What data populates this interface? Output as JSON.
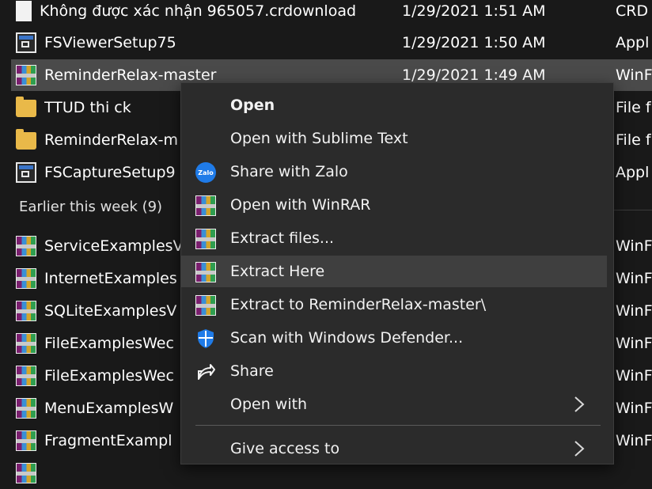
{
  "files": [
    {
      "name": "Không được xác nhận 965057.crdownload",
      "date": "1/29/2021 1:51 AM",
      "type": "CRD",
      "icon": "document-icon"
    },
    {
      "name": "FSViewerSetup75",
      "date": "1/29/2021 1:50 AM",
      "type": "Appl",
      "icon": "application-icon"
    },
    {
      "name": "ReminderRelax-master",
      "date": "1/29/2021 1:49 AM",
      "type": "WinF",
      "icon": "winrar-icon",
      "selected": true
    },
    {
      "name": "TTUD thi ck",
      "date": "",
      "type": "File f",
      "icon": "folder-icon"
    },
    {
      "name": "ReminderRelax-m",
      "date": "",
      "type": "File f",
      "icon": "folder-icon"
    },
    {
      "name": "FSCaptureSetup9",
      "date": "",
      "type": "Appl",
      "icon": "application-icon"
    }
  ],
  "group_header": "Earlier this week (9)",
  "files_earlier": [
    {
      "name": "ServiceExamplesV",
      "type": "WinF"
    },
    {
      "name": "InternetExamples",
      "type": "WinF"
    },
    {
      "name": "SQLiteExamplesV",
      "type": "WinF"
    },
    {
      "name": "FileExamplesWec",
      "type": "WinF"
    },
    {
      "name": "FileExamplesWec",
      "type": "WinF"
    },
    {
      "name": "MenuExamplesW",
      "type": "WinF"
    },
    {
      "name": "FragmentExampl",
      "type": "WinF"
    }
  ],
  "context_menu": {
    "items": [
      {
        "label": "Open",
        "icon": "",
        "bold": true
      },
      {
        "label": "Open with Sublime Text",
        "icon": ""
      },
      {
        "label": "Share with Zalo",
        "icon": "zalo-icon"
      },
      {
        "label": "Open with WinRAR",
        "icon": "winrar-icon"
      },
      {
        "label": "Extract files...",
        "icon": "winrar-icon"
      },
      {
        "label": "Extract Here",
        "icon": "winrar-icon",
        "hover": true
      },
      {
        "label": "Extract to ReminderRelax-master\\",
        "icon": "winrar-icon"
      },
      {
        "label": "Scan with Windows Defender...",
        "icon": "windows-defender-icon"
      },
      {
        "label": "Share",
        "icon": "share-icon"
      },
      {
        "label": "Open with",
        "icon": "",
        "submenu": true
      },
      {
        "label": "Give access to",
        "icon": "",
        "submenu": true
      }
    ],
    "zalo_icon_text": "Zalo"
  }
}
